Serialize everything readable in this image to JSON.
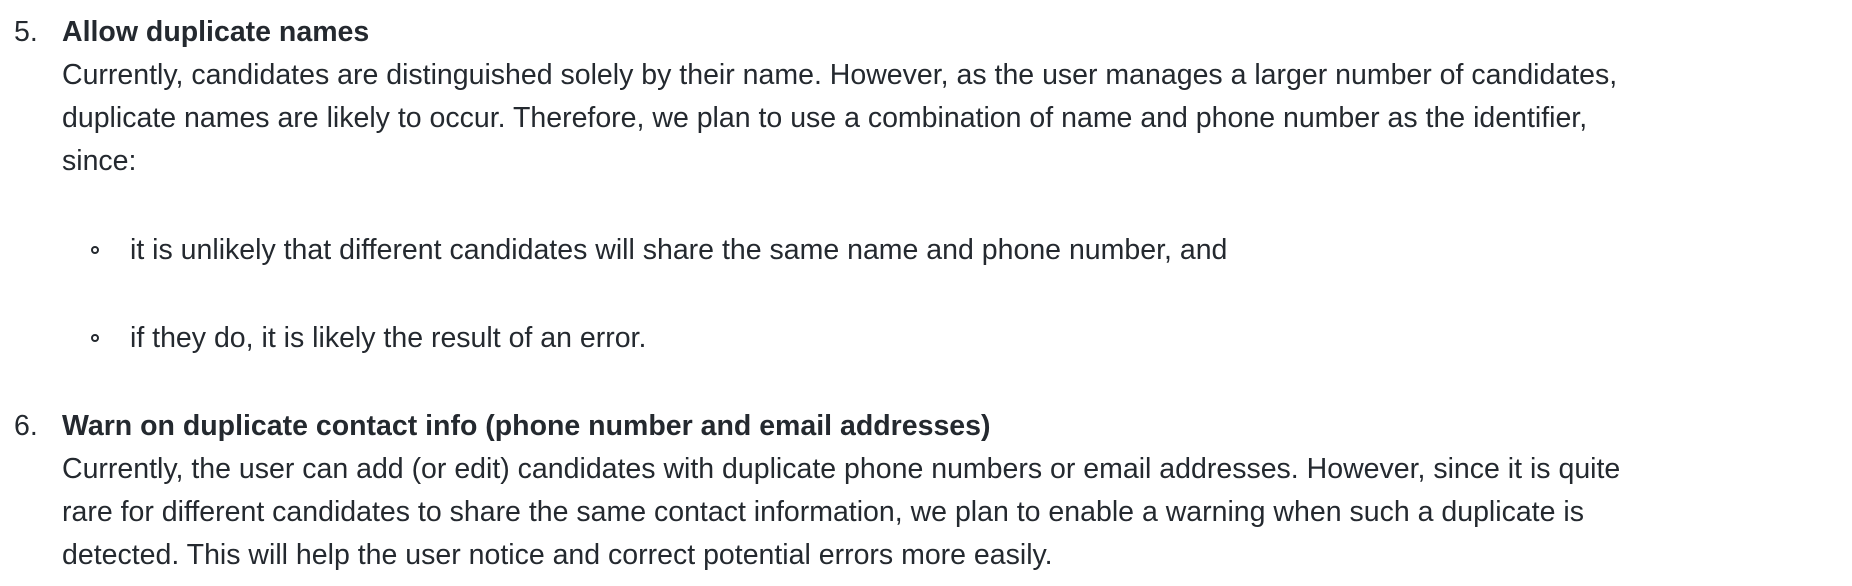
{
  "items": [
    {
      "number": "5.",
      "title": "Allow duplicate names",
      "lines": [
        "Currently, candidates are distinguished solely by their name. However, as the user manages a larger number of candidates,",
        "duplicate names are likely to occur. Therefore, we plan to use a combination of name and phone number as the identifier,",
        "since:"
      ],
      "bullets": [
        "it is unlikely that different candidates will share the same name and phone number, and",
        "if they do, it is likely the result of an error."
      ]
    },
    {
      "number": "6.",
      "title": "Warn on duplicate contact info (phone number and email addresses)",
      "lines": [
        "Currently, the user can add (or edit) candidates with duplicate phone numbers or email addresses. However, since it is quite",
        "rare for different candidates to share the same contact information, we plan to enable a warning when such a duplicate is",
        "detected. This will help the user notice and correct potential errors more easily."
      ]
    }
  ]
}
